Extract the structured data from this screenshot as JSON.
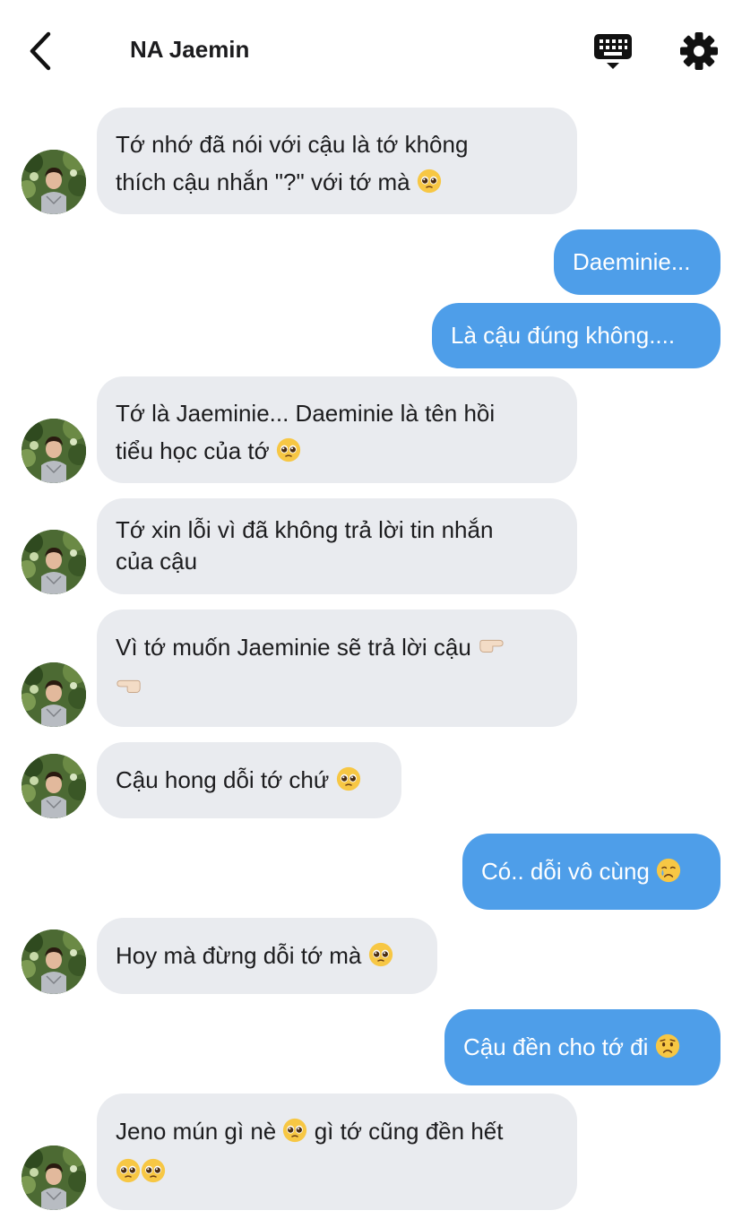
{
  "header": {
    "title": "NA Jaemin"
  },
  "icons": {
    "back": "chevron-left-icon",
    "keyboard": "keyboard-icon",
    "settings": "gear-icon",
    "pleading": "pleading-face-emoji",
    "pointing": "pointing-hand-emoji",
    "crying": "crying-face-emoji",
    "worried": "worried-face-emoji"
  },
  "colors": {
    "outgoing_bubble": "#4e9ee9",
    "incoming_bubble": "#e9ebef",
    "text": "#1c1c1e"
  },
  "messages": [
    {
      "from": "them",
      "lines": [
        "Tớ nhớ đã nói với cậu là tớ không",
        "thích cậu nhắn \"?\" với tớ mà"
      ],
      "emoji_after": "pleading"
    },
    {
      "from": "me",
      "text": "Daeminie..."
    },
    {
      "from": "me",
      "text": "Là cậu đúng không...."
    },
    {
      "from": "them",
      "lines": [
        "Tớ là Jaeminie... Daeminie là tên hồi",
        "tiểu học của tớ"
      ],
      "emoji_after": "pleading"
    },
    {
      "from": "them",
      "lines": [
        "Tớ xin lỗi vì đã không trả lời tin nhắn",
        "của cậu"
      ]
    },
    {
      "from": "them",
      "lines": [
        "Vì tớ muốn Jaeminie sẽ trả lời cậu"
      ],
      "emoji_after": "pointing"
    },
    {
      "from": "them",
      "text": "Cậu hong dỗi tớ chứ",
      "emoji_after": "pleading"
    },
    {
      "from": "me",
      "text": "Có.. dỗi vô cùng",
      "emoji_after": "crying"
    },
    {
      "from": "them",
      "text": "Hoy mà đừng dỗi tớ mà",
      "emoji_after": "pleading"
    },
    {
      "from": "me",
      "text": "Cậu đền cho tớ đi",
      "emoji_after": "worried"
    },
    {
      "from": "them",
      "lines": [
        "Jeno mún gì nè",
        "gì tớ cũng đền hết"
      ],
      "emoji_after": "pleading"
    }
  ]
}
